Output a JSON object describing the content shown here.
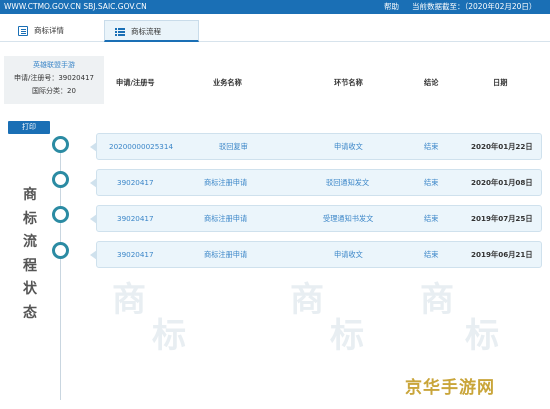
{
  "topbar": {
    "url": "WWW.CTMO.GOV.CN SBJ.SAIC.GOV.CN",
    "help": "帮助",
    "cutoff": "当前数据截至：（2020年02月20日）"
  },
  "tabs": [
    {
      "label": "商标详情",
      "icon": "doc-icon"
    },
    {
      "label": "商标流程",
      "icon": "list-icon"
    }
  ],
  "info": {
    "game": "英雄联盟手游",
    "reg_no": "申请/注册号：39020417",
    "intl_class": "国际分类：20"
  },
  "columns": {
    "no": "申请/注册号",
    "biz": "业务名称",
    "step": "环节名称",
    "result": "结论",
    "date": "日期"
  },
  "print_label": "打印",
  "vertical_label": [
    "商",
    "标",
    "流",
    "程",
    "状",
    "态"
  ],
  "records": [
    {
      "no": "20200000025314",
      "biz": "驳回复审",
      "step": "申请收文",
      "result": "结束",
      "date": "2020年01月22日"
    },
    {
      "no": "39020417",
      "biz": "商标注册申请",
      "step": "驳回通知发文",
      "result": "结束",
      "date": "2020年01月08日"
    },
    {
      "no": "39020417",
      "biz": "商标注册申请",
      "step": "受理通知书发文",
      "result": "结束",
      "date": "2019年07月25日"
    },
    {
      "no": "39020417",
      "biz": "商标注册申请",
      "step": "申请收文",
      "result": "结束",
      "date": "2019年06月21日"
    }
  ],
  "watermark": [
    "商",
    "标",
    "商",
    "标",
    "商",
    "标"
  ],
  "brand_watermark": "京华手游网",
  "colors": {
    "accent": "#1a6fb5",
    "node": "#2b8ba3",
    "row_bg": "#ebf5fb"
  }
}
